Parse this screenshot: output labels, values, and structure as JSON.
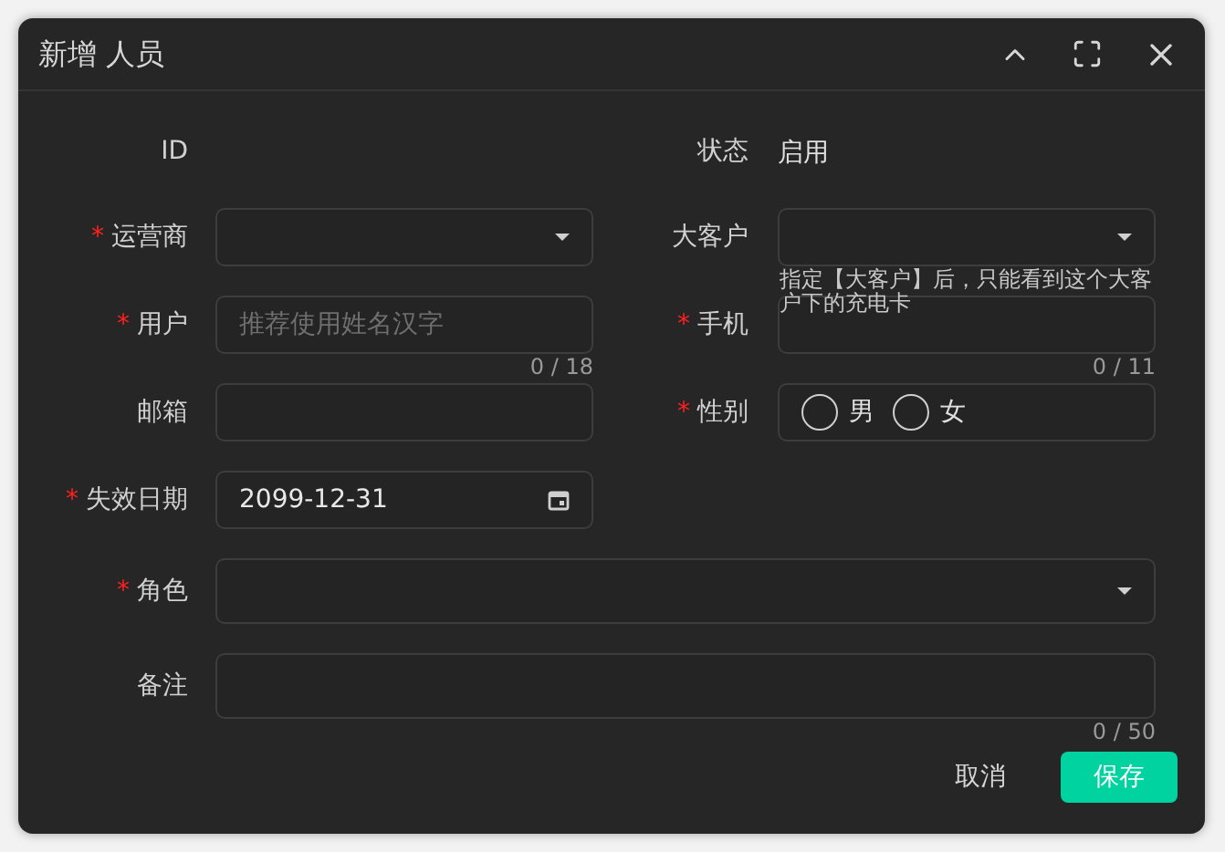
{
  "dialog": {
    "title": "新增 人员"
  },
  "required_mark": "*",
  "pairs": [
    [
      {
        "kind": "static",
        "label": "ID",
        "required": false
      },
      {
        "kind": "static",
        "label": "状态",
        "required": false,
        "value": "启用"
      }
    ],
    [
      {
        "kind": "select",
        "label": "运营商",
        "required": true
      },
      {
        "kind": "select",
        "label": "大客户",
        "required": false,
        "hint": "指定【大客户】后，只能看到这个大客户下的充电卡"
      }
    ],
    [
      {
        "kind": "text",
        "label": "用户",
        "required": true,
        "placeholder": "推荐使用姓名汉字",
        "counter": "0 / 18"
      },
      {
        "kind": "text",
        "label": "手机",
        "required": true,
        "counter": "0 / 11"
      }
    ],
    [
      {
        "kind": "text",
        "label": "邮箱",
        "required": false
      },
      {
        "kind": "radio",
        "label": "性别",
        "required": true,
        "options": [
          {
            "label": "男",
            "selected": false
          },
          {
            "label": "女",
            "selected": false
          }
        ]
      }
    ],
    [
      {
        "kind": "date",
        "label": "失效日期",
        "required": true,
        "value": "2099-12-31"
      }
    ]
  ],
  "wide": [
    {
      "kind": "select",
      "label": "角色",
      "required": true
    },
    {
      "kind": "text",
      "label": "备注",
      "required": false,
      "counter": "0 / 50"
    }
  ],
  "buttons": [
    {
      "kind": "text",
      "label": "取消"
    },
    {
      "kind": "primary",
      "label": "保存"
    }
  ]
}
